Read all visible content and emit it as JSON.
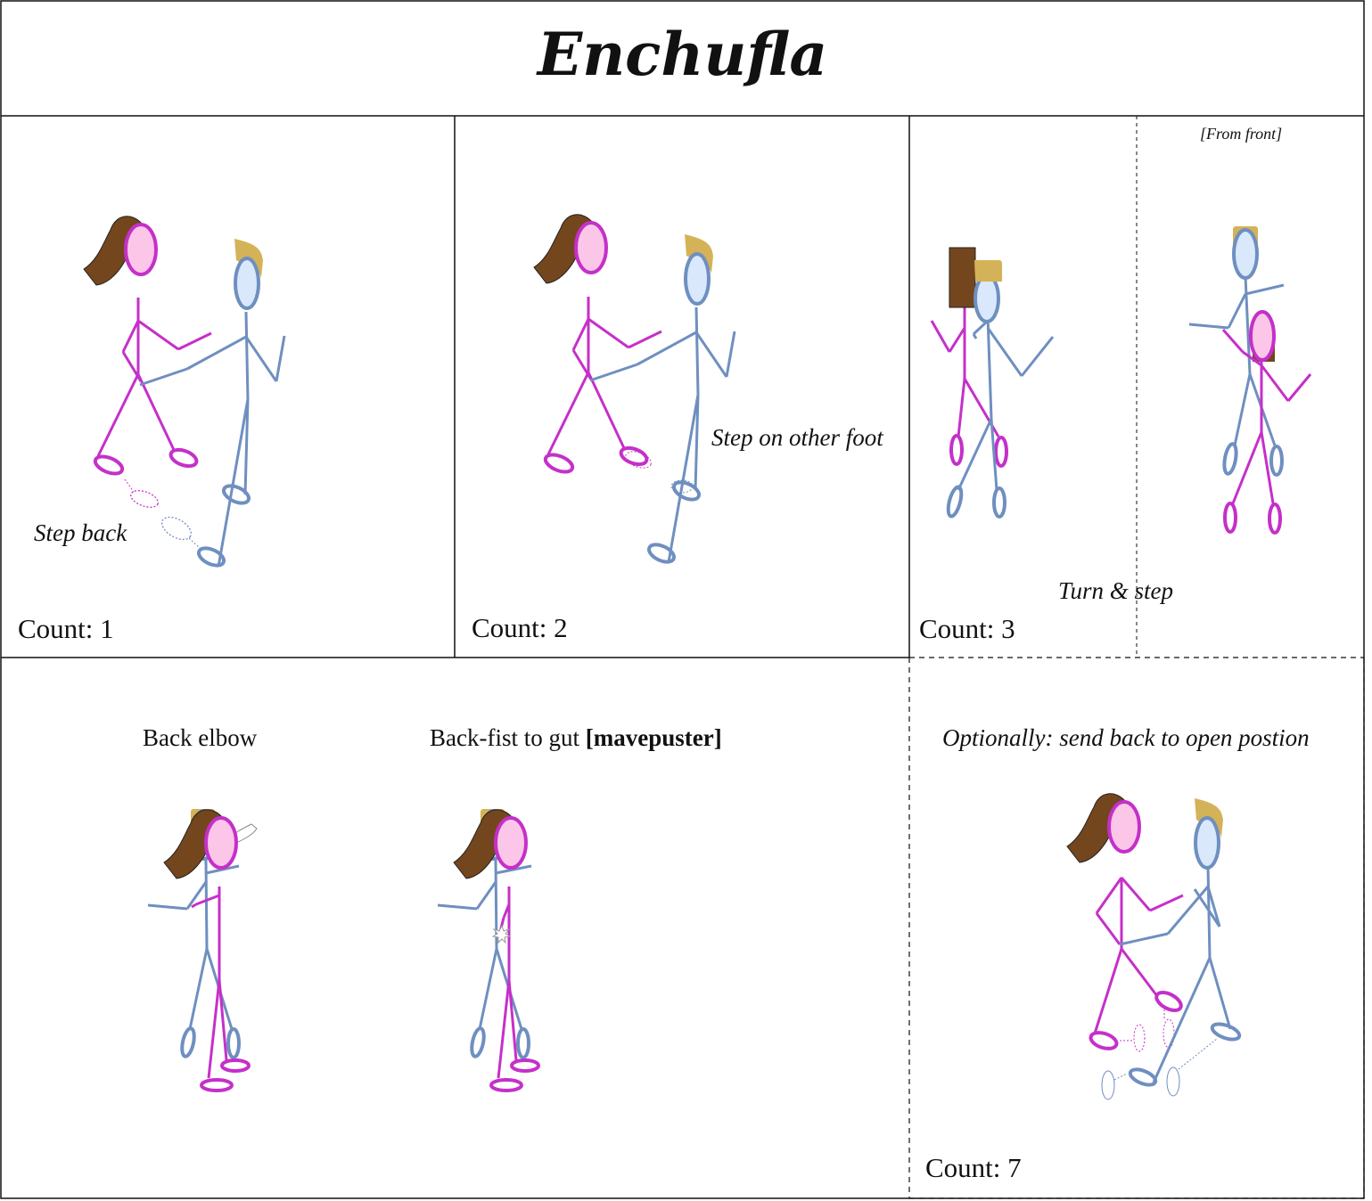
{
  "title": "Enchufla",
  "panels": [
    {
      "count": "Count: 1",
      "note": "Step back"
    },
    {
      "count": "Count: 2",
      "note": "Step on other foot"
    },
    {
      "count": "Count: 3",
      "note": "Turn & step",
      "subnote": "[From front]"
    },
    {
      "label_left": "Back elbow",
      "label_right_prefix": "Back-fist to gut ",
      "label_right_bold": "[mavepuster]"
    },
    {
      "count": "Count: 7",
      "note": "Optionally: send back to open postion"
    }
  ],
  "colors": {
    "woman": "#c530c9",
    "man": "#6f8fc0",
    "woman_face": "#fcc6e8",
    "man_face": "#d9e8fb",
    "woman_hair": "#74461d",
    "man_hair": "#d4b257"
  }
}
